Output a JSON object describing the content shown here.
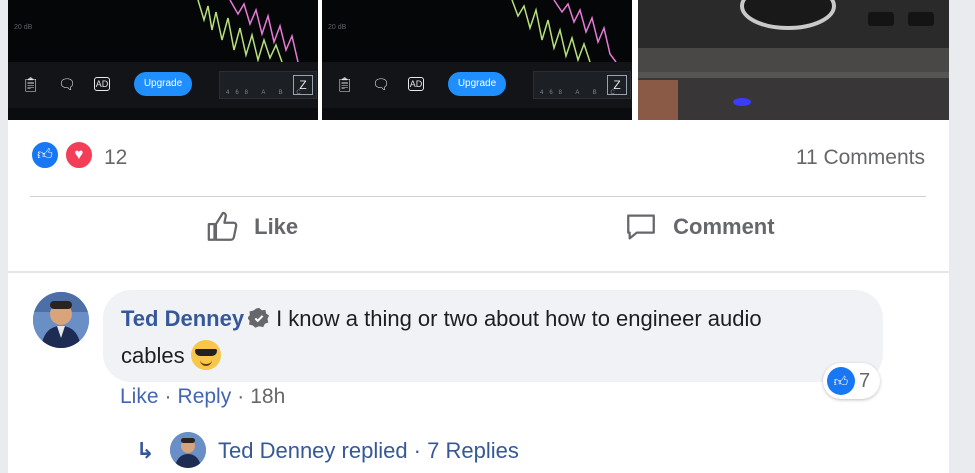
{
  "media": {
    "tiles": [
      {
        "upgrade_label": "Upgrade",
        "db_label": "20 dB",
        "meter_key": "Z",
        "meter_scale": "468 A B C"
      },
      {
        "upgrade_label": "Upgrade",
        "db_label": "20 dB",
        "meter_key": "Z",
        "meter_scale": "468 A B C"
      }
    ],
    "photo_description_icon": "stereo-photo"
  },
  "reactions": {
    "types": [
      "like",
      "love"
    ],
    "count": "12",
    "comments_count": "11 Comments"
  },
  "actions": {
    "like_label": "Like",
    "comment_label": "Comment"
  },
  "comment": {
    "author": "Ted Denney",
    "text_line1": "I know a thing or two about how to engineer audio",
    "text_line2": "cables",
    "emoji": "smiling-face-with-sunglasses",
    "like_action": "Like",
    "reply_action": "Reply",
    "separator": "·",
    "time": "18h",
    "reaction_count": "7"
  },
  "replies": {
    "summary": "Ted Denney replied · 7 Replies"
  },
  "colors": {
    "link": "#365899",
    "like_blue": "#1877f2",
    "love_red": "#f33e58",
    "upgrade_blue": "#1f8fff"
  }
}
